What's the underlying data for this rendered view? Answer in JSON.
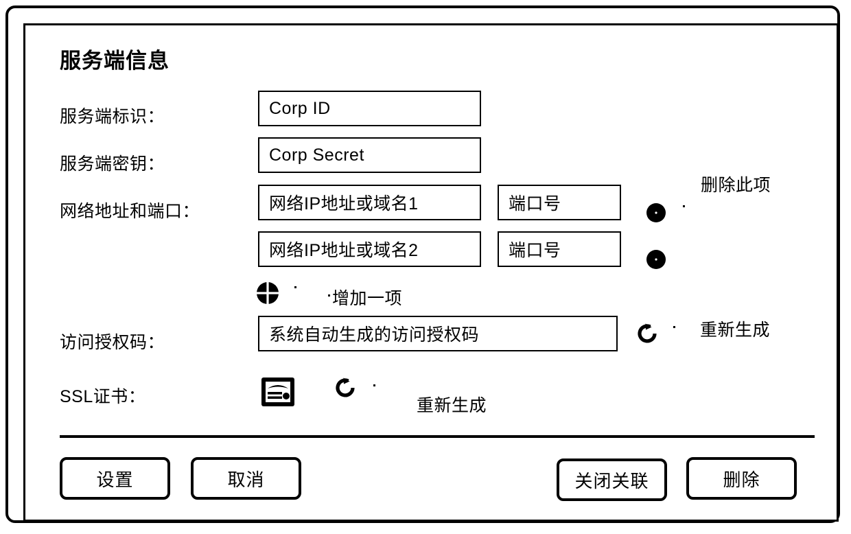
{
  "dialog": {
    "title": "服务端信息"
  },
  "fields": {
    "corp_id": {
      "label": "服务端标识：",
      "value": "Corp ID"
    },
    "corp_secret": {
      "label": "服务端密钥：",
      "value": "Corp Secret"
    },
    "network": {
      "label": "网络地址和端口：",
      "rows": [
        {
          "address": "网络IP地址或域名1",
          "port": "端口号"
        },
        {
          "address": "网络IP地址或域名2",
          "port": "端口号"
        }
      ],
      "delete_hint": "删除此项",
      "add_label": "增加一项"
    },
    "auth_code": {
      "label": "访问授权码：",
      "value": "系统自动生成的访问授权码",
      "regenerate_hint": "重新生成"
    },
    "ssl": {
      "label": "SSL证书：",
      "regenerate_hint": "重新生成"
    }
  },
  "icons": {
    "delete_item": "minus-circle-icon",
    "add_item": "plus-circle-icon",
    "regenerate": "refresh-icon",
    "certificate": "certificate-icon"
  },
  "footer": {
    "settings": "设置",
    "cancel": "取消",
    "close_association": "关闭关联",
    "delete": "删除"
  },
  "colors": {
    "stroke": "#000000",
    "background": "#ffffff"
  }
}
